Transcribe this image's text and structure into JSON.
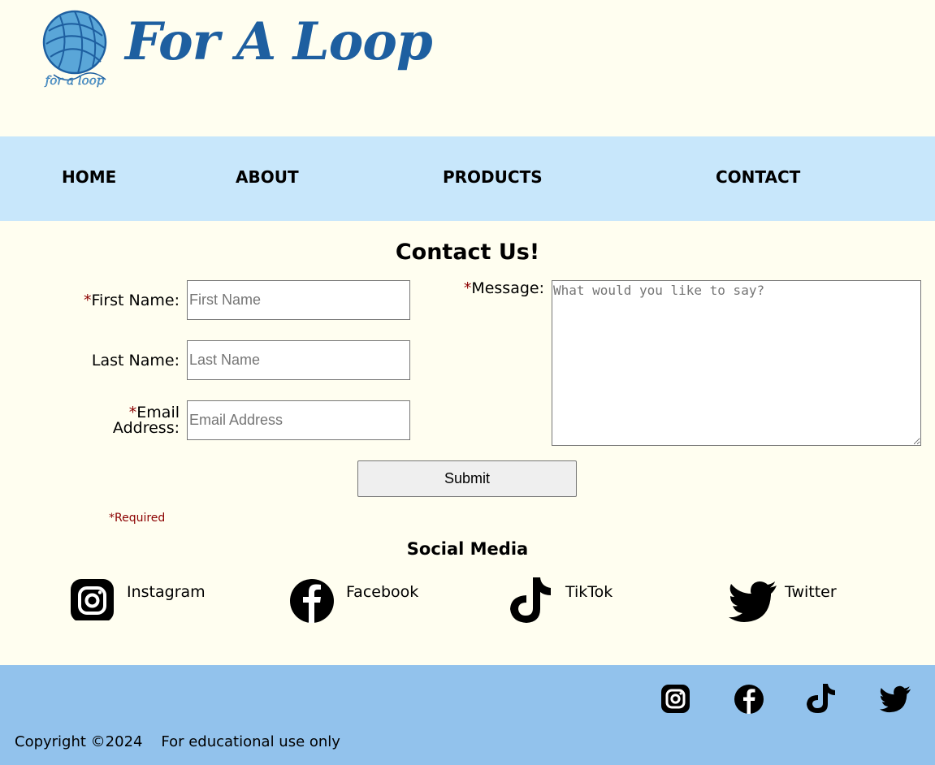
{
  "header": {
    "logo_script": "for a loop",
    "site_title": "For A Loop"
  },
  "nav": {
    "items": [
      {
        "label": "HOME"
      },
      {
        "label": "ABOUT"
      },
      {
        "label": "PRODUCTS"
      },
      {
        "label": "CONTACT"
      }
    ]
  },
  "contact": {
    "title": "Contact Us!",
    "required_marker": "*",
    "first_name_label": "First Name:",
    "first_name_placeholder": "First Name",
    "last_name_label": "Last Name:",
    "last_name_placeholder": "Last Name",
    "email_label_line1": "Email",
    "email_label_line2": "Address:",
    "email_placeholder": "Email Address",
    "message_label": "Message:",
    "message_placeholder": "What would you like to say?",
    "submit_label": "Submit",
    "required_note": "*Required"
  },
  "social": {
    "title": "Social Media",
    "items": [
      {
        "label": "Instagram",
        "icon": "instagram-icon"
      },
      {
        "label": "Facebook",
        "icon": "facebook-icon"
      },
      {
        "label": "TikTok",
        "icon": "tiktok-icon"
      },
      {
        "label": "Twitter",
        "icon": "twitter-icon"
      }
    ]
  },
  "footer": {
    "copyright": "Copyright ©2024",
    "disclaimer": "For educational use only"
  },
  "colors": {
    "brand_blue": "#1e5fa0",
    "nav_bg": "#c8e7fb",
    "footer_bg": "#92c2ec",
    "page_bg": "#fffef0",
    "required_red": "#8b0000"
  }
}
